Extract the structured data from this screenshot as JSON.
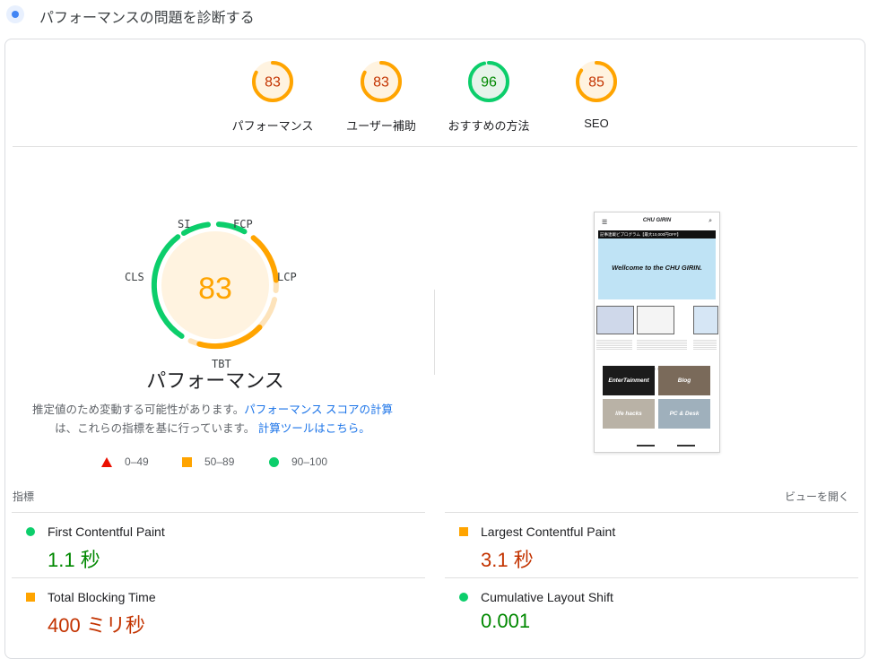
{
  "header": {
    "title": "パフォーマンスの問題を診断する"
  },
  "scores": [
    {
      "label": "パフォーマンス",
      "value": "83",
      "score": 83,
      "color": "#ffa400",
      "text_color": "#c33300",
      "bg": "#fff3e0"
    },
    {
      "label": "ユーザー補助",
      "value": "83",
      "score": 83,
      "color": "#ffa400",
      "text_color": "#c33300",
      "bg": "#fff3e0"
    },
    {
      "label": "おすすめの方法",
      "value": "96",
      "score": 96,
      "color": "#0cce6b",
      "text_color": "#008800",
      "bg": "#e6f4ea"
    },
    {
      "label": "SEO",
      "value": "85",
      "score": 85,
      "color": "#ffa400",
      "text_color": "#c33300",
      "bg": "#fff3e0"
    }
  ],
  "performance": {
    "score": "83",
    "title": "パフォーマンス",
    "metric_tags": {
      "si": "SI",
      "fcp": "FCP",
      "lcp": "LCP",
      "tbt": "TBT",
      "cls": "CLS"
    },
    "disclaimer_1": "推定値のため変動する可能性があります。",
    "disclaimer_link_1": "パフォーマンス スコアの計算",
    "disclaimer_2": "は、これらの指標を基に行っています。",
    "disclaimer_link_2": "計算ツールはこちら。"
  },
  "legend": {
    "fail": "0–49",
    "average": "50–89",
    "pass": "90–100"
  },
  "thumbnail": {
    "brand": "CHU GIRIN",
    "promo": "記事連載ビプログラム【最大10,000円OFF】",
    "hero_text": "Wellcome to the CHU GIRIN.",
    "tiles": [
      "EnterTainment",
      "Blog",
      "life hacks",
      "PC & Desk"
    ]
  },
  "metrics_section": {
    "label": "指標",
    "toggle": "ビューを開く"
  },
  "metrics": [
    {
      "name": "First Contentful Paint",
      "value": "1.1 秒",
      "status": "green"
    },
    {
      "name": "Largest Contentful Paint",
      "value": "3.1 秒",
      "status": "orange"
    },
    {
      "name": "Total Blocking Time",
      "value": "400 ミリ秒",
      "status": "orange"
    },
    {
      "name": "Cumulative Layout Shift",
      "value": "0.001",
      "status": "green"
    }
  ],
  "colors": {
    "pass": "#0cce6b",
    "average": "#ffa400",
    "fail": "#eb0f00",
    "link": "#1a73e8"
  }
}
